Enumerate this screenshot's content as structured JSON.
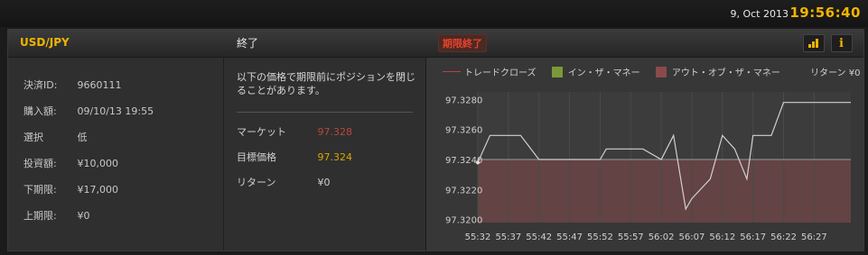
{
  "topbar": {
    "date": "9, Oct 2013",
    "time": "19:56:40"
  },
  "panel": {
    "pair": "USD/JPY",
    "status": "終了",
    "badge": "期限終了",
    "buttons": {
      "chart_icon": "bar-chart-icon",
      "info_icon": "info-icon"
    }
  },
  "details": [
    {
      "label": "決済ID:",
      "value": "9660111"
    },
    {
      "label": "購入額:",
      "value": "09/10/13 19:55"
    },
    {
      "label": "選択",
      "value": "低"
    },
    {
      "label": "投資額:",
      "value": "¥10,000"
    },
    {
      "label": "下期限:",
      "value": "¥17,000"
    },
    {
      "label": "上期限:",
      "value": "¥0"
    }
  ],
  "middle": {
    "note": "以下の価格で期限前にポジションを閉じることがあります。",
    "market": {
      "label": "マーケット",
      "value": "97.328"
    },
    "target": {
      "label": "目標価格",
      "value": "97.324"
    },
    "return": {
      "label": "リターン",
      "value": "¥0"
    }
  },
  "legend": {
    "trade_close": "トレードクローズ",
    "in_money": "イン・ザ・マネー",
    "out_money": "アウト・オブ・ザ・マネー",
    "return_label": "リターン ¥0",
    "colors": {
      "trade_close": "#c04040",
      "in_money": "#7a9a3a",
      "out_money": "#8a4a4a"
    }
  },
  "chart_data": {
    "type": "line",
    "x": [
      "55:32",
      "55:34",
      "55:37",
      "55:39",
      "55:42",
      "55:47",
      "55:52",
      "55:53",
      "55:57",
      "55:59",
      "56:02",
      "56:04",
      "56:06",
      "56:07",
      "56:10",
      "56:12",
      "56:14",
      "56:16",
      "56:17",
      "56:20",
      "56:22",
      "56:24",
      "56:27",
      "56:33"
    ],
    "values": [
      97.3238,
      97.3256,
      97.3256,
      97.3256,
      97.324,
      97.324,
      97.324,
      97.3247,
      97.3247,
      97.3247,
      97.324,
      97.3256,
      97.3207,
      97.3214,
      97.3227,
      97.3256,
      97.3247,
      97.3227,
      97.3256,
      97.3256,
      97.3278,
      97.3278,
      97.3278,
      97.3278
    ],
    "target": 97.324,
    "ylim": [
      97.3198,
      97.3285
    ],
    "yticks": [
      "97.3280",
      "97.3260",
      "97.3240",
      "97.3220",
      "97.3200"
    ],
    "ytick_values": [
      97.328,
      97.326,
      97.324,
      97.322,
      97.32
    ],
    "xticks": [
      "55:32",
      "55:37",
      "55:42",
      "55:47",
      "55:52",
      "55:57",
      "56:02",
      "56:07",
      "56:12",
      "56:17",
      "56:22",
      "56:27"
    ],
    "colors": {
      "line": "#d0d0d0",
      "out_region": "#6a4444",
      "target_line": "#9a9a9a"
    }
  }
}
